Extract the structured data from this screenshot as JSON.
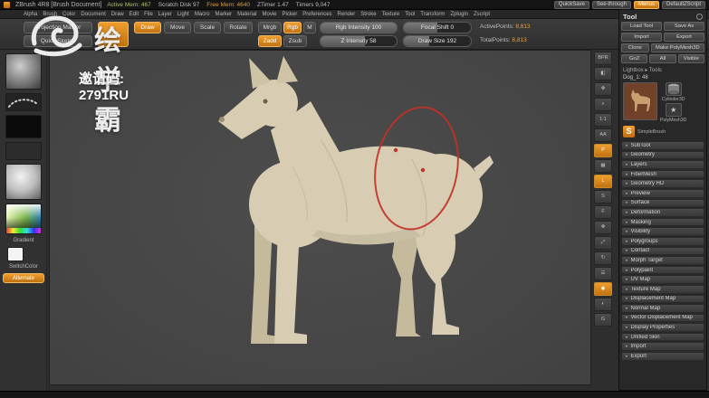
{
  "titlebar": {
    "title": "ZBrush 4R8  [Brush Document]",
    "stats": [
      {
        "label": "Active Mem: 467",
        "color": "#a9c46a"
      },
      {
        "label": "Scratch Disk 97",
        "color": "#bdbdbd"
      },
      {
        "label": "Free Mem: 4640",
        "color": "#e0973a"
      },
      {
        "label": "ZTimer 1.47",
        "color": "#bdbdbd"
      },
      {
        "label": "Timers 9,047",
        "color": "#bdbdbd"
      }
    ],
    "quicksave": "QuickSave",
    "seethrough": "See-through",
    "menus": "Menus",
    "defaultzscript": "DefaultZScript"
  },
  "menubar": {
    "items": [
      "Alpha",
      "Brush",
      "Color",
      "Document",
      "Draw",
      "Edit",
      "File",
      "Layer",
      "Light",
      "Macro",
      "Marker",
      "Material",
      "Movie",
      "Picker",
      "Preferences",
      "Render",
      "Stroke",
      "Texture",
      "Tool",
      "Transform",
      "Zplugin",
      "Zscript"
    ]
  },
  "shelf": {
    "projection_master": "Projection Master",
    "quick_sketch": "Quick Sketch",
    "edit": "Edit",
    "draw": "Draw",
    "move": "Move",
    "scale": "Scale",
    "rotate": "Rotate",
    "mrgb": "Mrgb",
    "rgb": "Rgb",
    "m": "M",
    "zadd": "Zadd",
    "zsub": "Zsub",
    "rgb_intensity": {
      "label": "Rgb Intensity",
      "value": "100",
      "pct": 100
    },
    "focal_shift": {
      "label": "Focal Shift",
      "value": "0",
      "pct": 50
    },
    "z_intensity": {
      "label": "Z Intensity",
      "value": "58",
      "pct": 58
    },
    "draw_size": {
      "label": "Draw Size",
      "value": "192",
      "pct": 38
    },
    "active_points_label": "ActivePoints:",
    "active_points_value": "8,813",
    "total_points_label": "TotalPoints:",
    "total_points_value": "8,813"
  },
  "left_tray": {
    "gradient": "Gradient",
    "switchcolor": "SwitchColor",
    "alternate": "Alternate"
  },
  "watermark": {
    "brand": "绘学霸",
    "invite": "邀请码: 2791RU"
  },
  "nav_strip": {
    "items": [
      {
        "name": "bpr-render",
        "glyph": "BPR",
        "accent": false
      },
      {
        "name": "render-mode",
        "glyph": "◧",
        "accent": false
      },
      {
        "name": "scroll-doc",
        "glyph": "✥",
        "accent": false
      },
      {
        "name": "zoom-doc",
        "glyph": "⌕",
        "accent": false
      },
      {
        "name": "actual-size",
        "glyph": "1:1",
        "accent": false
      },
      {
        "name": "aa-half",
        "glyph": "AA",
        "accent": false
      },
      {
        "name": "persp",
        "glyph": "P",
        "accent": true
      },
      {
        "name": "floor",
        "glyph": "▦",
        "accent": false
      },
      {
        "name": "local",
        "glyph": "L",
        "accent": true
      },
      {
        "name": "lsym",
        "glyph": "S",
        "accent": false
      },
      {
        "name": "frame",
        "glyph": "F",
        "accent": false
      },
      {
        "name": "move",
        "glyph": "✥",
        "accent": false
      },
      {
        "name": "scale",
        "glyph": "⤢",
        "accent": false
      },
      {
        "name": "rotate",
        "glyph": "↻",
        "accent": false
      },
      {
        "name": "xpose",
        "glyph": "☰",
        "accent": false
      },
      {
        "name": "solo",
        "glyph": "◉",
        "accent": true
      },
      {
        "name": "transp",
        "glyph": "◐",
        "accent": false
      },
      {
        "name": "ghost",
        "glyph": "G",
        "accent": false
      }
    ]
  },
  "tool_panel": {
    "title": "Tool",
    "load_tool": "Load Tool",
    "save_as": "Save As",
    "import": "Import",
    "export": "Export",
    "clone": "Clone",
    "make_polymesh": "Make PolyMesh3D",
    "goz": "GoZ",
    "all": "All",
    "visible": "Visible",
    "lightbox": "Lightbox ▸ Tools",
    "current_tool": "Dog_1: 48",
    "thumb_cylinder": "Cylinder3D",
    "thumb_polymesh": "PolyMesh3D",
    "simplebrush": "SimpleBrush",
    "sections": [
      "SubTool",
      "Geometry",
      "Layers",
      "FiberMesh",
      "Geometry HD",
      "Preview",
      "Surface",
      "Deformation",
      "Masking",
      "Visibility",
      "Polygroups",
      "Contact",
      "Morph Target",
      "Polypaint",
      "UV Map",
      "Texture Map",
      "Displacement Map",
      "Normal Map",
      "Vector Displacement Map",
      "Display Properties",
      "Unified Skin",
      "Import",
      "Export"
    ]
  },
  "colors": {
    "accent": "#d98319",
    "annotation": "#c23127",
    "canvas": "#474747",
    "model": "#d8cdb2"
  }
}
